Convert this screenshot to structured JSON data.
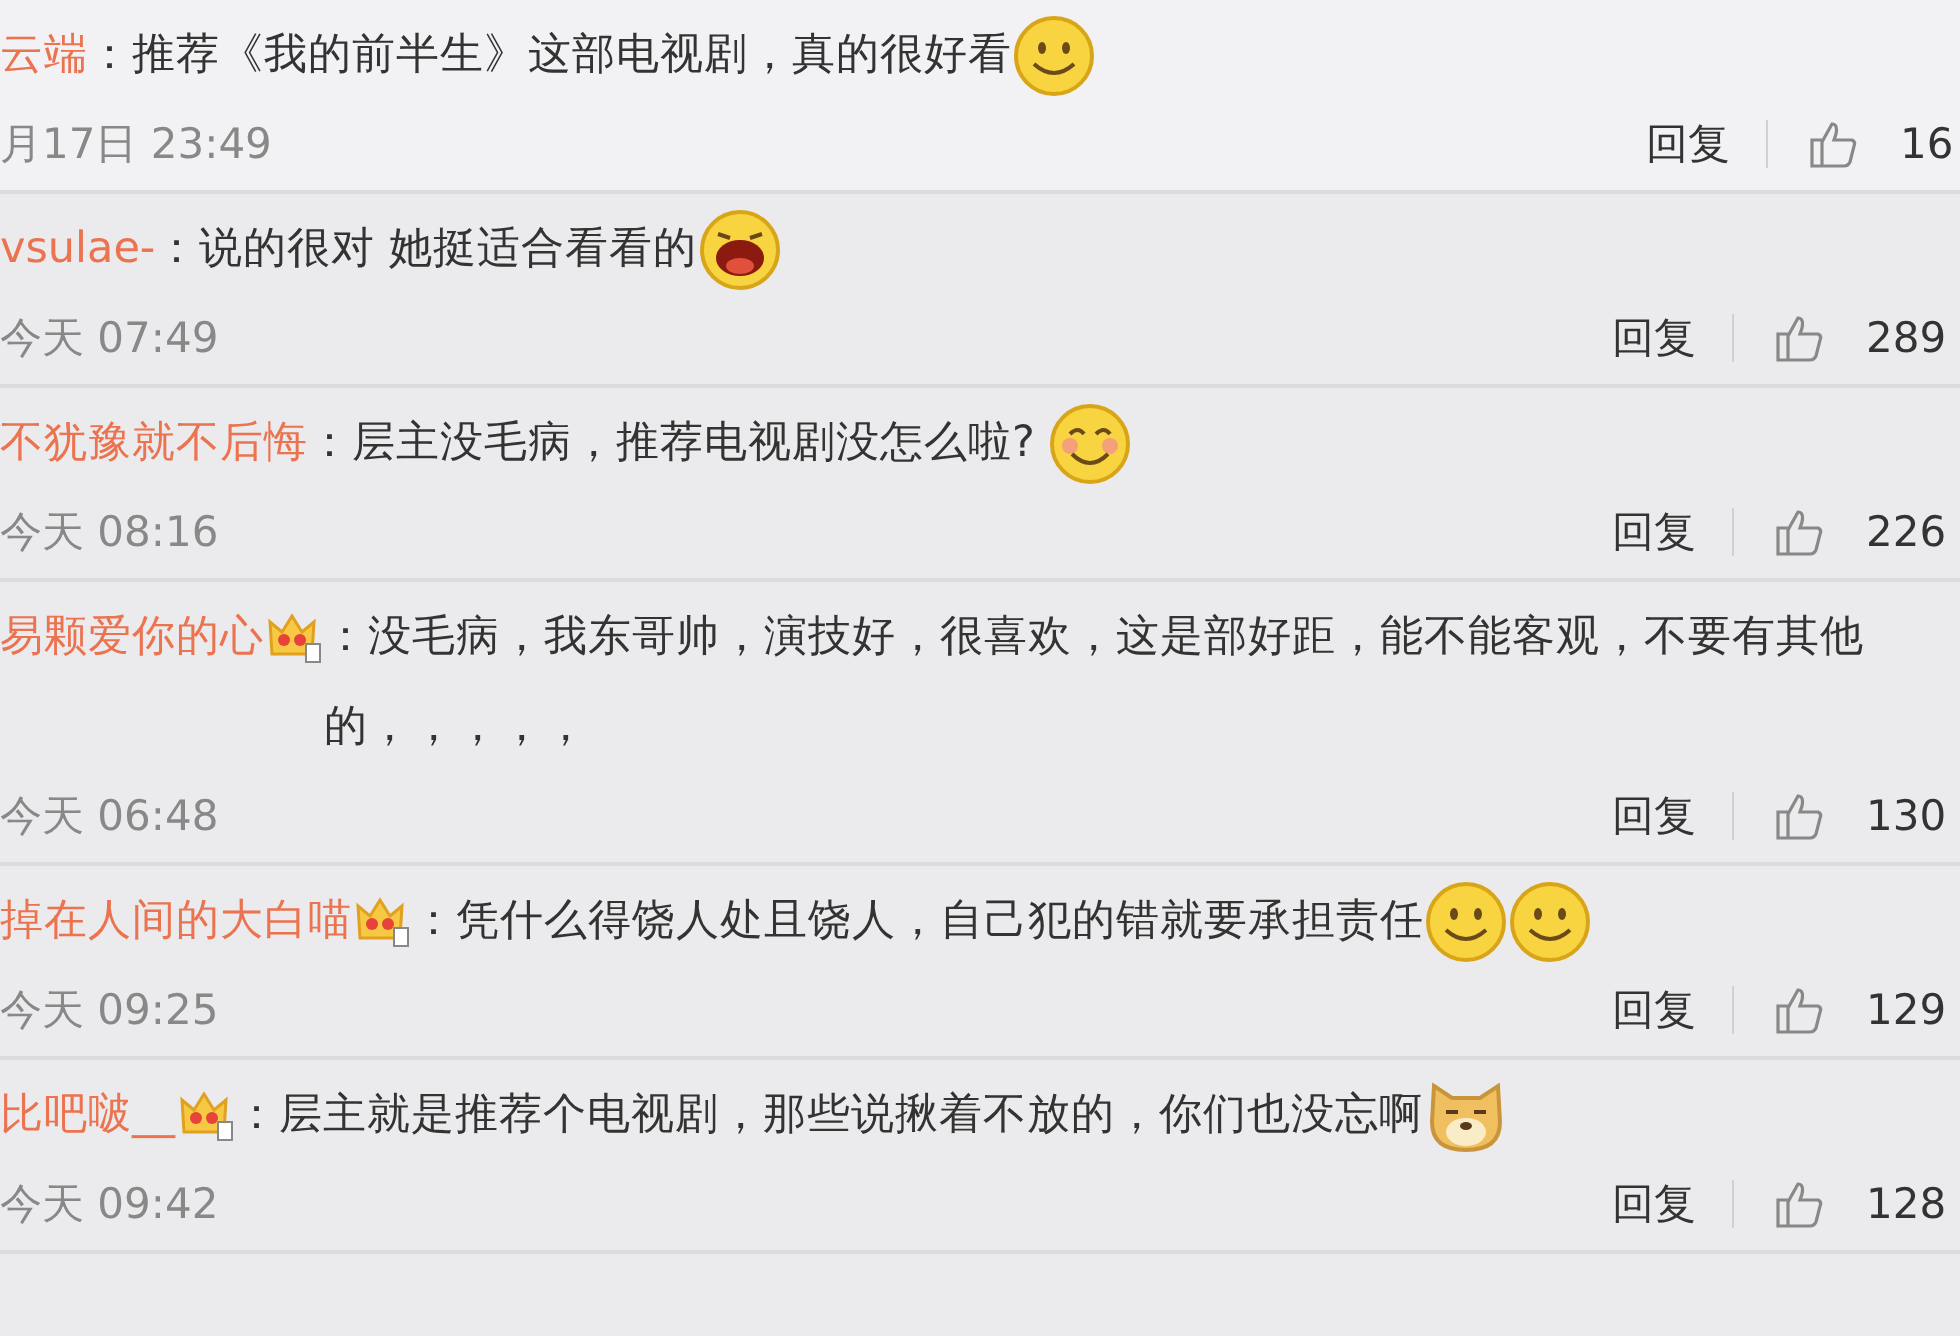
{
  "comments": [
    {
      "kind": "top",
      "name": "云端",
      "badge": false,
      "text": "推荐《我的前半生》这部电视剧，真的很好看",
      "emoticons": [
        {
          "kind": "smile"
        }
      ],
      "time": "月17日 23:49",
      "reply": "回复",
      "likes": "16"
    },
    {
      "kind": "reply",
      "name": "vsulae-",
      "badge": false,
      "text": "说的很对 她挺适合看看的",
      "emoticons": [
        {
          "kind": "laugh"
        }
      ],
      "time": "今天 07:49",
      "reply": "回复",
      "likes": "289"
    },
    {
      "kind": "reply",
      "name": "不犹豫就不后悔",
      "badge": false,
      "text": "层主没毛病，推荐电视剧没怎么啦? ",
      "emoticons": [
        {
          "kind": "blush"
        }
      ],
      "time": "今天 08:16",
      "reply": "回复",
      "likes": "226"
    },
    {
      "kind": "reply",
      "name": "易颗爱你的心",
      "badge": true,
      "text": "没毛病，我东哥帅，演技好，很喜欢，这是部好距，能不能客观，不要有其他的，，，，，",
      "time": "今天 06:48",
      "reply": "回复",
      "likes": "130"
    },
    {
      "kind": "reply",
      "name": "掉在人间的大白喵",
      "badge": true,
      "text": "凭什么得饶人处且饶人，自己犯的错就要承担责任",
      "emoticons": [
        {
          "kind": "smile"
        },
        {
          "kind": "smile"
        }
      ],
      "time": "今天 09:25",
      "reply": "回复",
      "likes": "129"
    },
    {
      "kind": "reply",
      "name": "比吧啵__",
      "badge": true,
      "text": "层主就是推荐个电视剧，那些说揪着不放的，你们也没忘啊",
      "emoticons": [
        {
          "kind": "doge"
        }
      ],
      "time": "今天 09:42",
      "reply": "回复",
      "likes": "128"
    }
  ],
  "separator": "："
}
